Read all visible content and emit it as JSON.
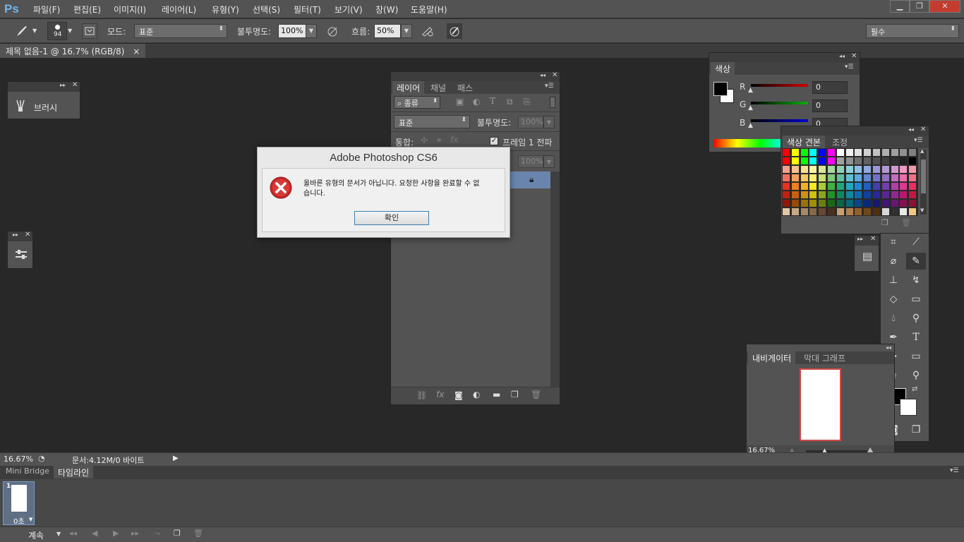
{
  "app": {
    "logo": "Ps"
  },
  "menu": [
    "파일(F)",
    "편집(E)",
    "이미지(I)",
    "레이어(L)",
    "유형(Y)",
    "선택(S)",
    "필터(T)",
    "보기(V)",
    "창(W)",
    "도움말(H)"
  ],
  "window_controls": {
    "minimize": "▁",
    "restore": "❐",
    "close": "✕"
  },
  "options": {
    "brush_size": "94",
    "mode_label": "모드:",
    "mode_value": "표준",
    "opacity_label": "불투명도:",
    "opacity_value": "100%",
    "flow_label": "흐름:",
    "flow_value": "50%",
    "workspace": "필수"
  },
  "document_tab": {
    "title": "제목 없음-1 @ 16.7% (RGB/8)",
    "close": "×"
  },
  "brush_panel": {
    "label": "브러시"
  },
  "layers_panel": {
    "tabs": [
      "레이어",
      "채널",
      "패스"
    ],
    "filter_kind": "종류",
    "blend_mode": "표준",
    "opacity_label": "불투명도:",
    "opacity_value": "100%",
    "unify_label": "통합:",
    "frame_label": "프레임 1 전파",
    "fill_value": "100%"
  },
  "color_panel": {
    "tab": "색상",
    "channels": [
      {
        "name": "R",
        "value": "0",
        "color": "#d40000"
      },
      {
        "name": "G",
        "value": "0",
        "color": "#00b000"
      },
      {
        "name": "B",
        "value": "0",
        "color": "#0000d4"
      }
    ]
  },
  "swatches_panel": {
    "tabs": [
      "색상 견본",
      "조정"
    ],
    "rows": [
      [
        "#ff0000",
        "#ffff00",
        "#00ff00",
        "#00ffff",
        "#0000ff",
        "#ff00ff",
        "#ffffff",
        "#f0f0f0",
        "#e0e0e0",
        "#d0d0d0",
        "#c0c0c0",
        "#b0b0b0",
        "#a0a0a0",
        "#909090",
        "#808080"
      ],
      [
        "#ff0000",
        "#ffff00",
        "#00ff00",
        "#00ffff",
        "#0000ff",
        "#ff00ff",
        "#a0a0a0",
        "#909090",
        "#707070",
        "#606060",
        "#505050",
        "#404040",
        "#303030",
        "#202020",
        "#000000"
      ],
      [
        "#f4a090",
        "#f8c090",
        "#fce090",
        "#fcf4a0",
        "#d8e898",
        "#a8d8a0",
        "#90d0b0",
        "#90d0d8",
        "#90c0e8",
        "#90a8e0",
        "#9898d8",
        "#b098d0",
        "#d098d0",
        "#f098c0",
        "#f098a8"
      ],
      [
        "#f07060",
        "#f4a060",
        "#f8c860",
        "#fcf070",
        "#c8e070",
        "#80c878",
        "#60c0a0",
        "#60c0d0",
        "#60a8e0",
        "#6088d0",
        "#7070c8",
        "#9070c0",
        "#c070c0",
        "#e870a8",
        "#f07088"
      ],
      [
        "#e83020",
        "#f08020",
        "#f4b020",
        "#f8e820",
        "#a8d030",
        "#40b040",
        "#20a878",
        "#20a8c0",
        "#2088d0",
        "#2060c0",
        "#4040b0",
        "#7040a8",
        "#b040a8",
        "#e03890",
        "#e83060"
      ],
      [
        "#c02010",
        "#c86010",
        "#d09010",
        "#d0c010",
        "#88a818",
        "#289028",
        "#108860",
        "#1088a0",
        "#1068b0",
        "#1040a0",
        "#282898",
        "#582890",
        "#902890",
        "#b81870",
        "#c01840"
      ],
      [
        "#901808",
        "#984808",
        "#a07008",
        "#a09008",
        "#688010",
        "#186818",
        "#086848",
        "#086878",
        "#084888",
        "#082878",
        "#181870",
        "#401870",
        "#681870",
        "#881050",
        "#901030"
      ],
      [
        "#e0c8a8",
        "#c8a888",
        "#a88868",
        "#886848",
        "#684830",
        "#483020",
        "#c8a070",
        "#b08050",
        "#906030",
        "#704818",
        "#503008",
        "#d8d8d8",
        "#303030",
        "#e8e8e8",
        "#f0c880"
      ]
    ]
  },
  "navigator": {
    "tabs": [
      "내비게이터",
      "막대 그래프"
    ],
    "zoom": "16.67%"
  },
  "status": {
    "zoom": "16.67%",
    "doc": "문서:4.12M/0 바이트"
  },
  "timeline": {
    "tabs": [
      "Mini Bridge",
      "타임라인"
    ],
    "frame_number": "1",
    "frame_delay": "0초",
    "loop": "계속"
  },
  "dialog": {
    "title": "Adobe Photoshop CS6",
    "message_line1": "올바른 유형의 문서가 아닙니다. 요청한 사항을 완료할 수 없",
    "message_line2": "습니다.",
    "ok": "확인"
  }
}
